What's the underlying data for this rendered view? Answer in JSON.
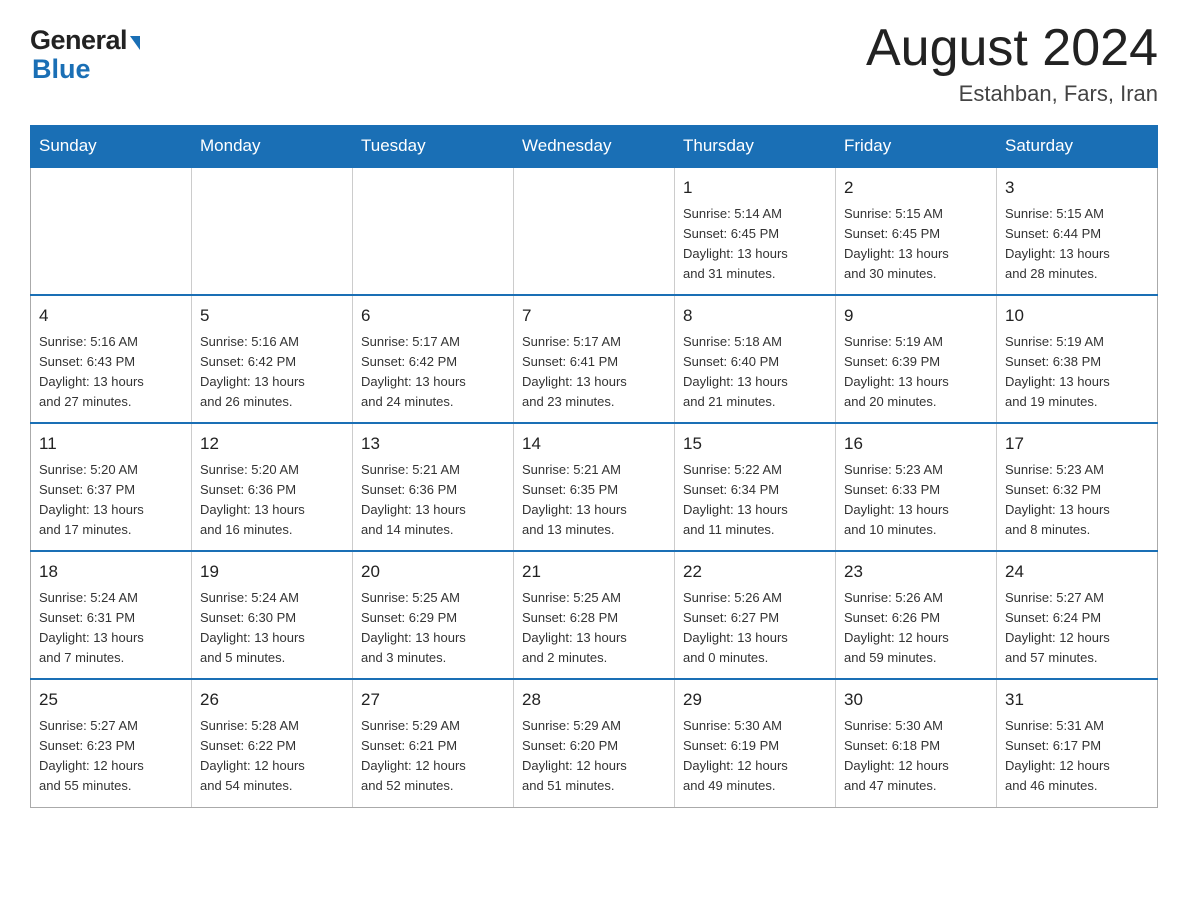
{
  "header": {
    "title": "August 2024",
    "subtitle": "Estahban, Fars, Iran"
  },
  "logo": {
    "part1": "General",
    "part2": "Blue"
  },
  "weekdays": [
    "Sunday",
    "Monday",
    "Tuesday",
    "Wednesday",
    "Thursday",
    "Friday",
    "Saturday"
  ],
  "weeks": [
    [
      {
        "day": "",
        "info": ""
      },
      {
        "day": "",
        "info": ""
      },
      {
        "day": "",
        "info": ""
      },
      {
        "day": "",
        "info": ""
      },
      {
        "day": "1",
        "info": "Sunrise: 5:14 AM\nSunset: 6:45 PM\nDaylight: 13 hours\nand 31 minutes."
      },
      {
        "day": "2",
        "info": "Sunrise: 5:15 AM\nSunset: 6:45 PM\nDaylight: 13 hours\nand 30 minutes."
      },
      {
        "day": "3",
        "info": "Sunrise: 5:15 AM\nSunset: 6:44 PM\nDaylight: 13 hours\nand 28 minutes."
      }
    ],
    [
      {
        "day": "4",
        "info": "Sunrise: 5:16 AM\nSunset: 6:43 PM\nDaylight: 13 hours\nand 27 minutes."
      },
      {
        "day": "5",
        "info": "Sunrise: 5:16 AM\nSunset: 6:42 PM\nDaylight: 13 hours\nand 26 minutes."
      },
      {
        "day": "6",
        "info": "Sunrise: 5:17 AM\nSunset: 6:42 PM\nDaylight: 13 hours\nand 24 minutes."
      },
      {
        "day": "7",
        "info": "Sunrise: 5:17 AM\nSunset: 6:41 PM\nDaylight: 13 hours\nand 23 minutes."
      },
      {
        "day": "8",
        "info": "Sunrise: 5:18 AM\nSunset: 6:40 PM\nDaylight: 13 hours\nand 21 minutes."
      },
      {
        "day": "9",
        "info": "Sunrise: 5:19 AM\nSunset: 6:39 PM\nDaylight: 13 hours\nand 20 minutes."
      },
      {
        "day": "10",
        "info": "Sunrise: 5:19 AM\nSunset: 6:38 PM\nDaylight: 13 hours\nand 19 minutes."
      }
    ],
    [
      {
        "day": "11",
        "info": "Sunrise: 5:20 AM\nSunset: 6:37 PM\nDaylight: 13 hours\nand 17 minutes."
      },
      {
        "day": "12",
        "info": "Sunrise: 5:20 AM\nSunset: 6:36 PM\nDaylight: 13 hours\nand 16 minutes."
      },
      {
        "day": "13",
        "info": "Sunrise: 5:21 AM\nSunset: 6:36 PM\nDaylight: 13 hours\nand 14 minutes."
      },
      {
        "day": "14",
        "info": "Sunrise: 5:21 AM\nSunset: 6:35 PM\nDaylight: 13 hours\nand 13 minutes."
      },
      {
        "day": "15",
        "info": "Sunrise: 5:22 AM\nSunset: 6:34 PM\nDaylight: 13 hours\nand 11 minutes."
      },
      {
        "day": "16",
        "info": "Sunrise: 5:23 AM\nSunset: 6:33 PM\nDaylight: 13 hours\nand 10 minutes."
      },
      {
        "day": "17",
        "info": "Sunrise: 5:23 AM\nSunset: 6:32 PM\nDaylight: 13 hours\nand 8 minutes."
      }
    ],
    [
      {
        "day": "18",
        "info": "Sunrise: 5:24 AM\nSunset: 6:31 PM\nDaylight: 13 hours\nand 7 minutes."
      },
      {
        "day": "19",
        "info": "Sunrise: 5:24 AM\nSunset: 6:30 PM\nDaylight: 13 hours\nand 5 minutes."
      },
      {
        "day": "20",
        "info": "Sunrise: 5:25 AM\nSunset: 6:29 PM\nDaylight: 13 hours\nand 3 minutes."
      },
      {
        "day": "21",
        "info": "Sunrise: 5:25 AM\nSunset: 6:28 PM\nDaylight: 13 hours\nand 2 minutes."
      },
      {
        "day": "22",
        "info": "Sunrise: 5:26 AM\nSunset: 6:27 PM\nDaylight: 13 hours\nand 0 minutes."
      },
      {
        "day": "23",
        "info": "Sunrise: 5:26 AM\nSunset: 6:26 PM\nDaylight: 12 hours\nand 59 minutes."
      },
      {
        "day": "24",
        "info": "Sunrise: 5:27 AM\nSunset: 6:24 PM\nDaylight: 12 hours\nand 57 minutes."
      }
    ],
    [
      {
        "day": "25",
        "info": "Sunrise: 5:27 AM\nSunset: 6:23 PM\nDaylight: 12 hours\nand 55 minutes."
      },
      {
        "day": "26",
        "info": "Sunrise: 5:28 AM\nSunset: 6:22 PM\nDaylight: 12 hours\nand 54 minutes."
      },
      {
        "day": "27",
        "info": "Sunrise: 5:29 AM\nSunset: 6:21 PM\nDaylight: 12 hours\nand 52 minutes."
      },
      {
        "day": "28",
        "info": "Sunrise: 5:29 AM\nSunset: 6:20 PM\nDaylight: 12 hours\nand 51 minutes."
      },
      {
        "day": "29",
        "info": "Sunrise: 5:30 AM\nSunset: 6:19 PM\nDaylight: 12 hours\nand 49 minutes."
      },
      {
        "day": "30",
        "info": "Sunrise: 5:30 AM\nSunset: 6:18 PM\nDaylight: 12 hours\nand 47 minutes."
      },
      {
        "day": "31",
        "info": "Sunrise: 5:31 AM\nSunset: 6:17 PM\nDaylight: 12 hours\nand 46 minutes."
      }
    ]
  ]
}
